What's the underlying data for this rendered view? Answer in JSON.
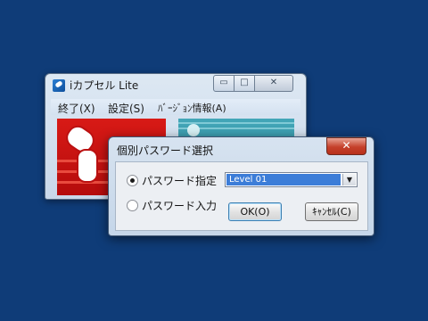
{
  "app_window": {
    "title": "iカプセル Lite",
    "controls": {
      "minimize": "▭",
      "maximize": "□",
      "close": "✕"
    },
    "menu": [
      {
        "label": "終了(X)"
      },
      {
        "label": "設定(S)"
      },
      {
        "label": "ﾊﾞｰｼﾞｮﾝ情報(A)"
      }
    ]
  },
  "dialog": {
    "title": "個別パスワード選択",
    "close_glyph": "✕",
    "options": [
      {
        "label": "パスワード指定",
        "selected": true
      },
      {
        "label": "パスワード入力",
        "selected": false
      }
    ],
    "level_select": {
      "value": "Level 01",
      "arrow": "▼"
    },
    "ok_label": "OK(O)",
    "cancel_label": "ｷｬﾝｾﾙ(C)"
  },
  "colors": {
    "desktop": "#0f3c78",
    "panel_red": "#c8110f",
    "panel_teal": "#3a9aad",
    "selection": "#3c7dd8"
  }
}
